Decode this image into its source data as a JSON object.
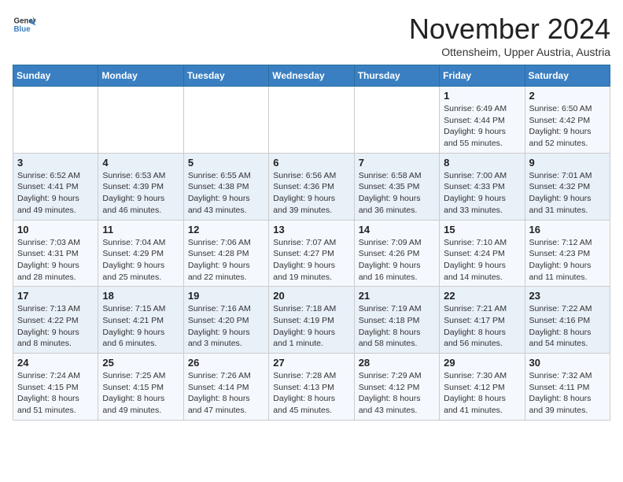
{
  "logo": {
    "line1": "General",
    "line2": "Blue"
  },
  "title": "November 2024",
  "location": "Ottensheim, Upper Austria, Austria",
  "weekdays": [
    "Sunday",
    "Monday",
    "Tuesday",
    "Wednesday",
    "Thursday",
    "Friday",
    "Saturday"
  ],
  "weeks": [
    [
      {
        "day": "",
        "info": ""
      },
      {
        "day": "",
        "info": ""
      },
      {
        "day": "",
        "info": ""
      },
      {
        "day": "",
        "info": ""
      },
      {
        "day": "",
        "info": ""
      },
      {
        "day": "1",
        "info": "Sunrise: 6:49 AM\nSunset: 4:44 PM\nDaylight: 9 hours and 55 minutes."
      },
      {
        "day": "2",
        "info": "Sunrise: 6:50 AM\nSunset: 4:42 PM\nDaylight: 9 hours and 52 minutes."
      }
    ],
    [
      {
        "day": "3",
        "info": "Sunrise: 6:52 AM\nSunset: 4:41 PM\nDaylight: 9 hours and 49 minutes."
      },
      {
        "day": "4",
        "info": "Sunrise: 6:53 AM\nSunset: 4:39 PM\nDaylight: 9 hours and 46 minutes."
      },
      {
        "day": "5",
        "info": "Sunrise: 6:55 AM\nSunset: 4:38 PM\nDaylight: 9 hours and 43 minutes."
      },
      {
        "day": "6",
        "info": "Sunrise: 6:56 AM\nSunset: 4:36 PM\nDaylight: 9 hours and 39 minutes."
      },
      {
        "day": "7",
        "info": "Sunrise: 6:58 AM\nSunset: 4:35 PM\nDaylight: 9 hours and 36 minutes."
      },
      {
        "day": "8",
        "info": "Sunrise: 7:00 AM\nSunset: 4:33 PM\nDaylight: 9 hours and 33 minutes."
      },
      {
        "day": "9",
        "info": "Sunrise: 7:01 AM\nSunset: 4:32 PM\nDaylight: 9 hours and 31 minutes."
      }
    ],
    [
      {
        "day": "10",
        "info": "Sunrise: 7:03 AM\nSunset: 4:31 PM\nDaylight: 9 hours and 28 minutes."
      },
      {
        "day": "11",
        "info": "Sunrise: 7:04 AM\nSunset: 4:29 PM\nDaylight: 9 hours and 25 minutes."
      },
      {
        "day": "12",
        "info": "Sunrise: 7:06 AM\nSunset: 4:28 PM\nDaylight: 9 hours and 22 minutes."
      },
      {
        "day": "13",
        "info": "Sunrise: 7:07 AM\nSunset: 4:27 PM\nDaylight: 9 hours and 19 minutes."
      },
      {
        "day": "14",
        "info": "Sunrise: 7:09 AM\nSunset: 4:26 PM\nDaylight: 9 hours and 16 minutes."
      },
      {
        "day": "15",
        "info": "Sunrise: 7:10 AM\nSunset: 4:24 PM\nDaylight: 9 hours and 14 minutes."
      },
      {
        "day": "16",
        "info": "Sunrise: 7:12 AM\nSunset: 4:23 PM\nDaylight: 9 hours and 11 minutes."
      }
    ],
    [
      {
        "day": "17",
        "info": "Sunrise: 7:13 AM\nSunset: 4:22 PM\nDaylight: 9 hours and 8 minutes."
      },
      {
        "day": "18",
        "info": "Sunrise: 7:15 AM\nSunset: 4:21 PM\nDaylight: 9 hours and 6 minutes."
      },
      {
        "day": "19",
        "info": "Sunrise: 7:16 AM\nSunset: 4:20 PM\nDaylight: 9 hours and 3 minutes."
      },
      {
        "day": "20",
        "info": "Sunrise: 7:18 AM\nSunset: 4:19 PM\nDaylight: 9 hours and 1 minute."
      },
      {
        "day": "21",
        "info": "Sunrise: 7:19 AM\nSunset: 4:18 PM\nDaylight: 8 hours and 58 minutes."
      },
      {
        "day": "22",
        "info": "Sunrise: 7:21 AM\nSunset: 4:17 PM\nDaylight: 8 hours and 56 minutes."
      },
      {
        "day": "23",
        "info": "Sunrise: 7:22 AM\nSunset: 4:16 PM\nDaylight: 8 hours and 54 minutes."
      }
    ],
    [
      {
        "day": "24",
        "info": "Sunrise: 7:24 AM\nSunset: 4:15 PM\nDaylight: 8 hours and 51 minutes."
      },
      {
        "day": "25",
        "info": "Sunrise: 7:25 AM\nSunset: 4:15 PM\nDaylight: 8 hours and 49 minutes."
      },
      {
        "day": "26",
        "info": "Sunrise: 7:26 AM\nSunset: 4:14 PM\nDaylight: 8 hours and 47 minutes."
      },
      {
        "day": "27",
        "info": "Sunrise: 7:28 AM\nSunset: 4:13 PM\nDaylight: 8 hours and 45 minutes."
      },
      {
        "day": "28",
        "info": "Sunrise: 7:29 AM\nSunset: 4:12 PM\nDaylight: 8 hours and 43 minutes."
      },
      {
        "day": "29",
        "info": "Sunrise: 7:30 AM\nSunset: 4:12 PM\nDaylight: 8 hours and 41 minutes."
      },
      {
        "day": "30",
        "info": "Sunrise: 7:32 AM\nSunset: 4:11 PM\nDaylight: 8 hours and 39 minutes."
      }
    ]
  ]
}
